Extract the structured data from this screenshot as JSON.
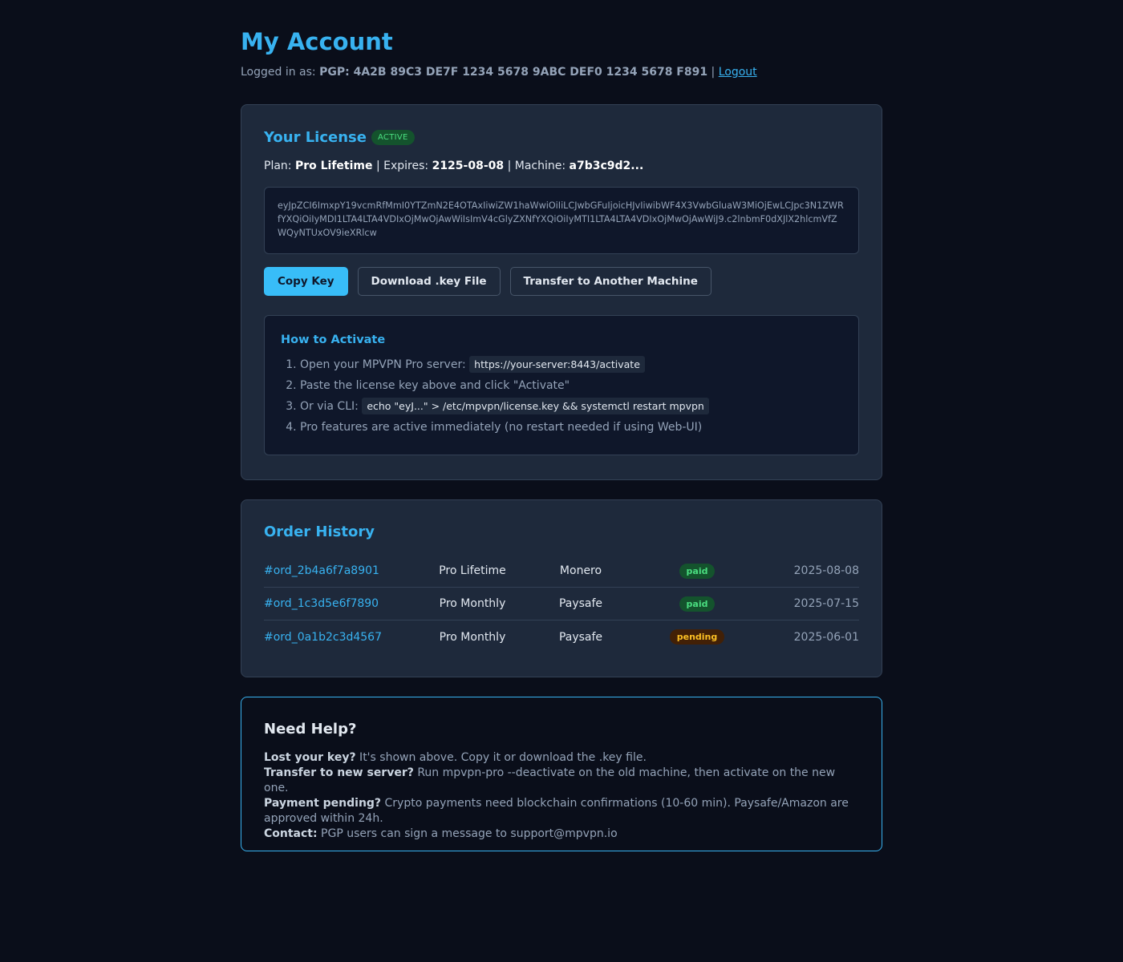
{
  "page": {
    "title": "My Account"
  },
  "account": {
    "logged_in_label": "Logged in as:",
    "pgp_id": "PGP: 4A2B 89C3 DE7F 1234 5678 9ABC DEF0 1234 5678 F891",
    "separator": "|",
    "logout_label": "Logout"
  },
  "license": {
    "title": "Your License",
    "status": "ACTIVE",
    "plan_label": "Plan:",
    "plan_value": "Pro Lifetime",
    "expires_label": "Expires:",
    "expires_value": "2125-08-08",
    "machine_label": "Machine:",
    "machine_value": "a7b3c9d2...",
    "key": "eyJpZCI6ImxpY19vcmRfMmI0YTZmN2E4OTAxIiwiZW1haWwiOiIiLCJwbGFuIjoicHJvIiwibWF4X3VwbGluaW3MiOjEwLCJpc3N1ZWRfYXQiOiIyMDI1LTA4LTA4VDIxOjMwOjAwWiIsImV4cGlyZXNfYXQiOiIyMTI1LTA4LTA4VDIxOjMwOjAwWiJ9.c2lnbmF0dXJlX2hlcmVfZWQyNTUxOV9ieXRlcw",
    "buttons": {
      "copy": "Copy Key",
      "download": "Download .key File",
      "transfer": "Transfer to Another Machine"
    }
  },
  "howto": {
    "title": "How to Activate",
    "step1_text": "Open your MPVPN Pro server:",
    "step1_code": "https://your-server:8443/activate",
    "step2_text": "Paste the license key above and click \"Activate\"",
    "step3_text": "Or via CLI:",
    "step3_code": "echo \"eyJ...\" > /etc/mpvpn/license.key && systemctl restart mpvpn",
    "step4_text": "Pro features are active immediately (no restart needed if using Web-UI)"
  },
  "orders": {
    "title": "Order History",
    "rows": [
      {
        "id": "#ord_2b4a6f7a8901",
        "plan": "Pro Lifetime",
        "payment": "Monero",
        "status": "paid",
        "date": "2025-08-08"
      },
      {
        "id": "#ord_1c3d5e6f7890",
        "plan": "Pro Monthly",
        "payment": "Paysafe",
        "status": "paid",
        "date": "2025-07-15"
      },
      {
        "id": "#ord_0a1b2c3d4567",
        "plan": "Pro Monthly",
        "payment": "Paysafe",
        "status": "pending",
        "date": "2025-06-01"
      }
    ]
  },
  "help": {
    "title": "Need Help?",
    "q1": "Lost your key?",
    "a1": " It's shown above. Copy it or download the .key file.",
    "q2": "Transfer to new server?",
    "a2": " Run mpvpn-pro --deactivate on the old machine, then activate on the new one.",
    "q3": "Payment pending?",
    "a3": " Crypto payments need blockchain confirmations (10-60 min). Paysafe/Amazon are approved within 24h.",
    "q4": "Contact:",
    "a4": " PGP users can sign a message to support@mpvpn.io"
  },
  "colors": {
    "background": "#0a0e1a",
    "card": "#1e293b",
    "accent": "#38b2f0",
    "paid": "#4ade80",
    "pending": "#fbbf24"
  }
}
